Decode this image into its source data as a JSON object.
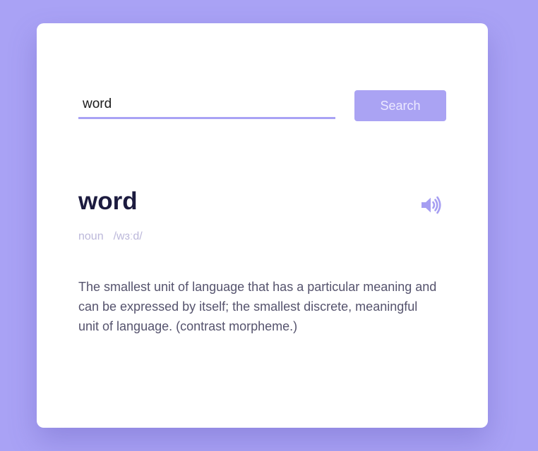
{
  "search": {
    "value": "word",
    "button_label": "Search"
  },
  "entry": {
    "word": "word",
    "part_of_speech": "noun",
    "phonetic": "/wɜːd/",
    "definition": "The smallest unit of language that has a particular meaning and can be expressed by itself; the smallest discrete, meaningful unit of language. (contrast morpheme.)",
    "audio_icon": "speaker-volume-icon"
  },
  "colors": {
    "background": "#a9a2f5",
    "accent": "#a9a2f5",
    "title": "#1c1b3f",
    "muted": "#bcb8da",
    "body_text": "#55536d"
  }
}
